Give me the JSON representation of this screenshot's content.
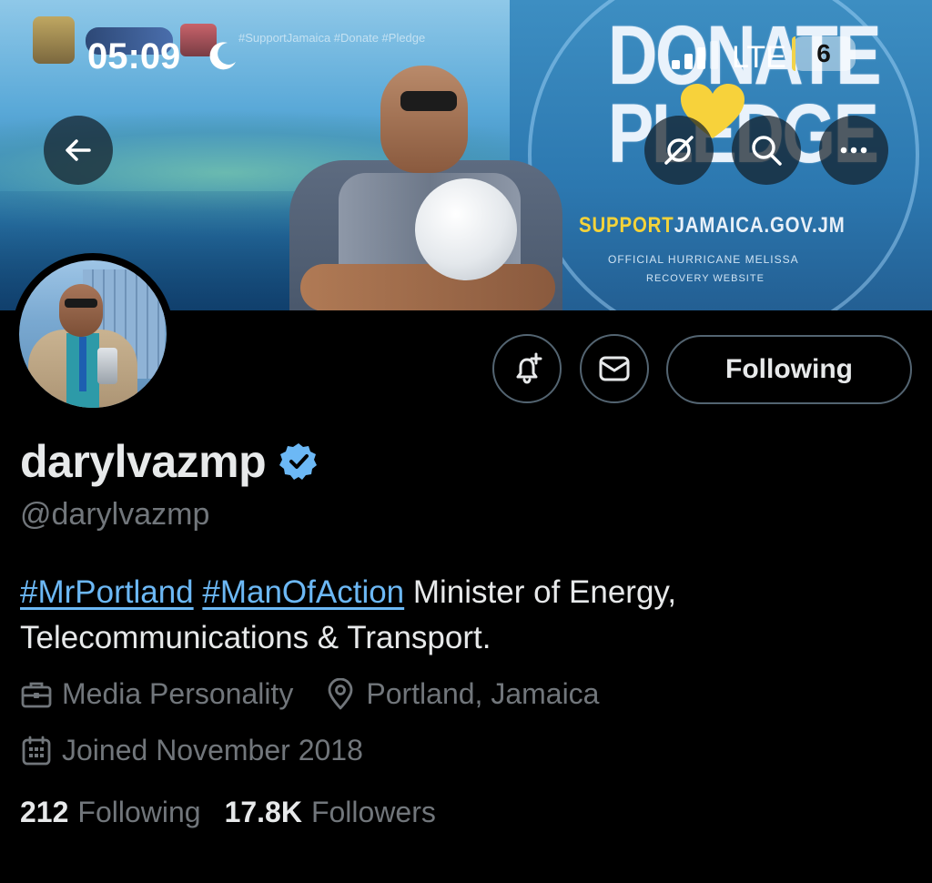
{
  "status_bar": {
    "time": "05:09",
    "network": "LTE",
    "battery_level": "6",
    "battery_fraction": 0.06,
    "signal_bars_active": 3,
    "signal_bars_total": 4
  },
  "banner": {
    "headline_line1": "DONATE",
    "headline_line2": "PLEDGE",
    "website_highlight": "SUPPORT",
    "website_rest": "JAMAICA.GOV.JM",
    "tagline_1": "OFFICIAL HURRICANE MELISSA",
    "tagline_2": "RECOVERY WEBSITE",
    "hashtags": "#SupportJamaica #Donate #Pledge",
    "accent_color": "#f4d33a"
  },
  "profile": {
    "display_name": "darylvazmp",
    "handle": "@darylvazmp",
    "verified": true,
    "bio_hashtag_1": "#MrPortland",
    "bio_hashtag_2": "#ManOfAction",
    "bio_text": " Minister of Energy, Telecommunications & Transport.",
    "category": "Media Personality",
    "location": "Portland, Jamaica",
    "joined": "Joined November 2018",
    "following_count": "212",
    "following_label": "Following",
    "followers_count": "17.8K",
    "followers_label": "Followers"
  },
  "actions": {
    "following_button_label": "Following"
  },
  "colors": {
    "background": "#000000",
    "primary_text": "#e7e9ea",
    "secondary_text": "#71767b",
    "link": "#6cb8f5",
    "border": "#536471",
    "verified_badge": "#1d9bf0"
  },
  "icons": {
    "back": "arrow-left-icon",
    "grok": "grok-icon",
    "search": "search-icon",
    "more": "more-horizontal-icon",
    "notify": "bell-plus-icon",
    "message": "envelope-icon",
    "category": "briefcase-icon",
    "location": "location-pin-icon",
    "joined": "calendar-icon",
    "verified": "verified-badge-icon"
  }
}
